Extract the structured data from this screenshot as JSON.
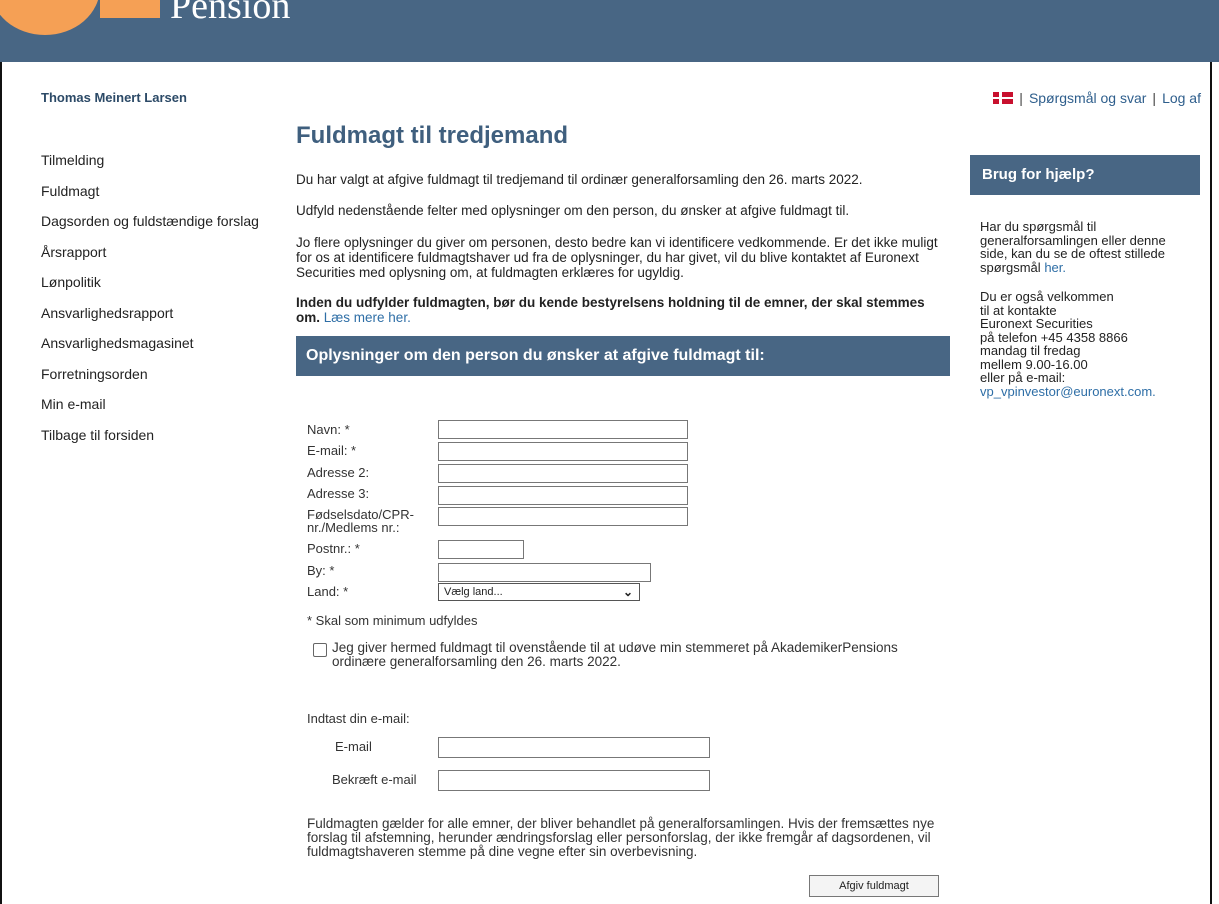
{
  "header": {
    "logo_text": "Pension"
  },
  "user": {
    "name": "Thomas Meinert Larsen"
  },
  "toplinks": {
    "faq": "Spørgsmål og svar",
    "logout": "Log af"
  },
  "sidebar": {
    "items": [
      "Tilmelding",
      "Fuldmagt",
      "Dagsorden og fuldstændige forslag",
      "Årsrapport",
      "Lønpolitik",
      "Ansvarlighedsrapport",
      "Ansvarlighedsmagasinet",
      "Forretningsorden",
      "Min e-mail",
      "Tilbage til forsiden"
    ]
  },
  "main": {
    "title": "Fuldmagt til tredjemand",
    "p1": "Du har valgt at afgive fuldmagt til tredjemand til ordinær generalforsamling den 26. marts 2022.",
    "p2": "Udfyld nedenstående felter med oplysninger om den person, du ønsker at afgive fuldmagt til.",
    "p3": "Jo flere oplysninger du giver om personen, desto bedre kan vi identificere vedkommende. Er det ikke muligt for os at identificere fuldmagtshaver ud fra de oplysninger, du har givet, vil du blive kontaktet af Euronext Securities med oplysning om, at fuldmagten erklæres for ugyldig.",
    "p4_bold": "Inden du udfylder fuldmagten, bør du kende bestyrelsens holdning til de emner, der skal stemmes om.",
    "p4_link": "Læs mere her.",
    "section_header": "Oplysninger om den person du ønsker at afgive fuldmagt til:",
    "form": {
      "name_label": "Navn: *",
      "email_label": "E-mail: *",
      "address2_label": "Adresse 2:",
      "address3_label": "Adresse 3:",
      "dob_label": "Fødselsdato/CPR-nr./Medlems nr.:",
      "zip_label": "Postnr.: *",
      "city_label": "By: *",
      "country_label": "Land: *",
      "country_value": "Vælg land...",
      "required_note": "* Skal som minimum udfyldes",
      "consent_text": "Jeg giver hermed fuldmagt til ovenstående til at udøve min stemmeret på AkademikerPensions ordinære generalforsamling den 26. marts 2022."
    },
    "email_section": {
      "intro": "Indtast din e-mail:",
      "email_label": "E-mail",
      "confirm_label": "Bekræft e-mail"
    },
    "footer_text": "Fuldmagten gælder for alle emner, der bliver behandlet på generalforsamlingen. Hvis der fremsættes nye forslag til afstemning, herunder ændringsforslag eller personforslag, der ikke fremgår af dagsordenen, vil fuldmagtshaveren stemme på dine vegne efter sin overbevisning.",
    "submit_label": "Afgiv fuldmagt"
  },
  "help": {
    "title": "Brug for hjælp?",
    "text1": "Har du spørgsmål til generalforsamlingen eller denne side, kan du se de oftest stillede spørgsmål",
    "link1": "her.",
    "text2_lines": [
      "Du er også velkommen",
      "til at kontakte",
      "Euronext Securities",
      "på telefon +45 4358 8866",
      "mandag til fredag",
      "mellem 9.00-16.00",
      "eller på e-mail:"
    ],
    "email": "vp_vpinvestor@euronext.com."
  },
  "colors": {
    "header": "#486684",
    "logo": "#f5a055",
    "link": "#2e6ea6"
  }
}
